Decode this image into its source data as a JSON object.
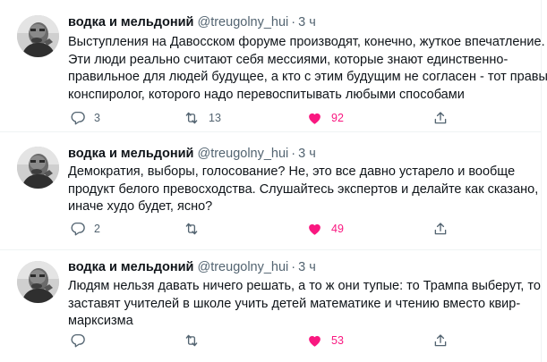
{
  "tweets": [
    {
      "name": "водка и мельдоний",
      "handle": "@treugolny_hui",
      "dot": "·",
      "time": "3 ч",
      "lines": [
        "Выступления на Давосском форуме производят, конечно, жуткое впечатление.",
        "Эти люди реально считают себя мессиями, которые знают единственно-",
        "правильное для людей будущее, а кто с этим будущим не согласен - тот правый",
        "конспиролог, которого надо перевоспитывать любыми способами"
      ],
      "replies": "3",
      "retweets": "13",
      "likes": "92",
      "liked": true
    },
    {
      "name": "водка и мельдоний",
      "handle": "@treugolny_hui",
      "dot": "·",
      "time": "3 ч",
      "lines": [
        "Демократия, выборы, голосование? Не, это все давно устарело и вообще",
        "продукт белого превосходства. Слушайтесь экспертов и делайте как сказано,",
        "иначе  худо будет, ясно?"
      ],
      "replies": "2",
      "retweets": "",
      "likes": "49",
      "liked": true
    },
    {
      "name": "водка и мельдоний",
      "handle": "@treugolny_hui",
      "dot": "·",
      "time": "3 ч",
      "lines": [
        "Людям нельзя давать ничего решать, а то ж они тупые: то Трампа выберут, то",
        "заставят учителей в школе учить детей математике и чтению вместо квир-",
        "марксизма"
      ],
      "replies": "",
      "retweets": "",
      "likes": "53",
      "liked": true
    }
  ],
  "icons": {
    "reply": "reply-bubble-icon",
    "retweet": "retweet-arrows-icon",
    "like": "heart-filled-icon",
    "share": "share-upload-icon"
  },
  "colors": {
    "text": "#0f1419",
    "secondary": "#536471",
    "like": "#f91880",
    "divider": "#eff3f4"
  }
}
